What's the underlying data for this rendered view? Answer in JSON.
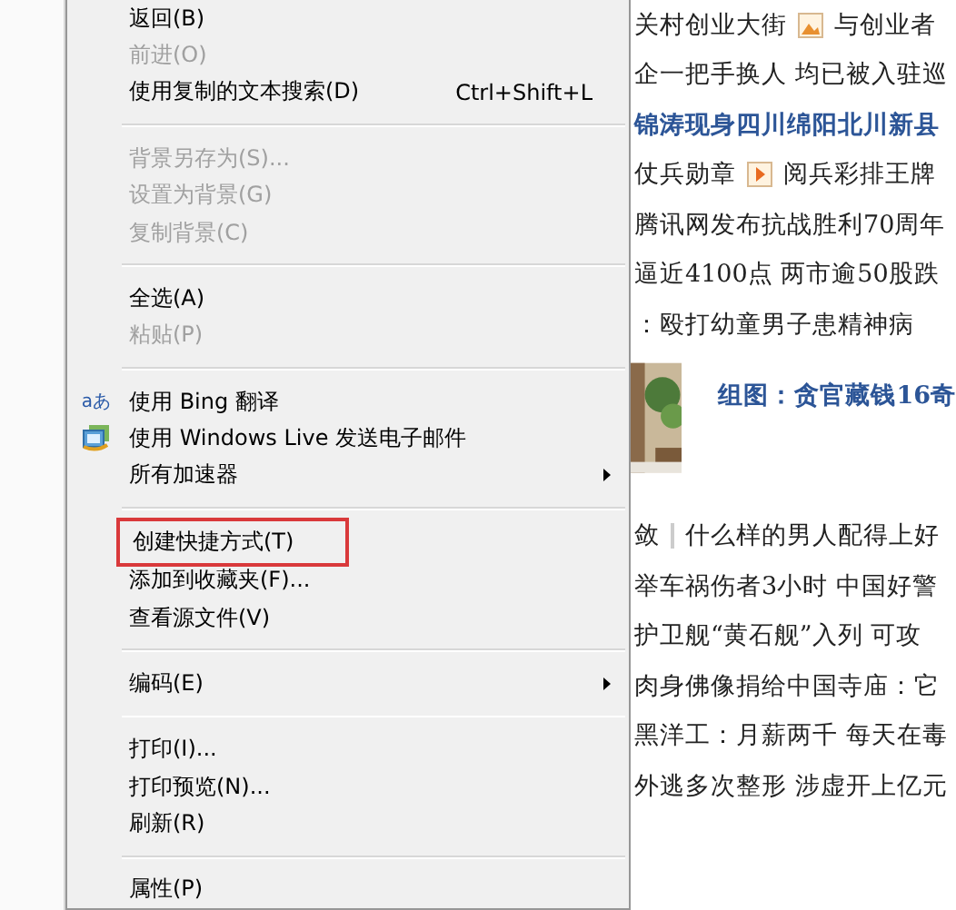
{
  "context_menu": {
    "groups": [
      [
        {
          "label": "返回(B)",
          "disabled": false
        },
        {
          "label": "前进(O)",
          "disabled": true
        },
        {
          "label": "使用复制的文本搜索(D)",
          "disabled": false,
          "shortcut": "Ctrl+Shift+L"
        }
      ],
      [
        {
          "label": "背景另存为(S)...",
          "disabled": true
        },
        {
          "label": "设置为背景(G)",
          "disabled": true
        },
        {
          "label": "复制背景(C)",
          "disabled": true
        }
      ],
      [
        {
          "label": "全选(A)",
          "disabled": false
        },
        {
          "label": "粘贴(P)",
          "disabled": true
        }
      ],
      [
        {
          "label": "使用 Bing 翻译",
          "disabled": false,
          "kind": "text_icon",
          "icon_text": "aあ"
        },
        {
          "label": "使用 Windows Live 发送电子邮件",
          "disabled": false,
          "kind": "image_icon"
        },
        {
          "label": "所有加速器",
          "disabled": false,
          "submenu": true
        }
      ],
      [
        {
          "label": "创建快捷方式(T)",
          "disabled": false,
          "highlighted": true
        },
        {
          "label": "添加到收藏夹(F)...",
          "disabled": false
        },
        {
          "label": "查看源文件(V)",
          "disabled": false
        }
      ],
      [
        {
          "label": "编码(E)",
          "disabled": false,
          "submenu": true
        }
      ],
      [
        {
          "label": "打印(I)...",
          "disabled": false
        },
        {
          "label": "打印预览(N)...",
          "disabled": false
        },
        {
          "label": "刷新(R)",
          "disabled": false
        }
      ],
      [
        {
          "label": "属性(P)",
          "disabled": false
        }
      ]
    ]
  },
  "news": [
    {
      "kind": "image_link",
      "parts": [
        "关村创业大街",
        "与创业者"
      ]
    },
    {
      "kind": "link",
      "parts": [
        "企一把手换人 均已被入驻巡"
      ]
    },
    {
      "kind": "headline",
      "parts": [
        "锦涛现身四川绵阳北川新县"
      ]
    },
    {
      "kind": "video_link",
      "parts": [
        "仗兵勋章",
        "阅兵彩排王牌"
      ]
    },
    {
      "kind": "link",
      "parts": [
        "腾讯网发布抗战胜利70周年"
      ]
    },
    {
      "kind": "link",
      "parts": [
        "逼近4100点 两市逾50股跌"
      ]
    },
    {
      "kind": "link",
      "parts": [
        "：殴打幼童男子患精神病"
      ]
    },
    {
      "parts": [
        "组图：贪官藏钱16奇"
      ]
    },
    {
      "kind": "divided_link",
      "parts": [
        "敛",
        "什么样的男人配得上好"
      ]
    },
    {
      "kind": "link",
      "parts": [
        "举车祸伤者3小时 中国好警"
      ]
    },
    {
      "kind": "link",
      "parts": [
        "护卫舰“黄石舰”入列 可攻"
      ]
    },
    {
      "kind": "link",
      "parts": [
        "肉身佛像捐给中国寺庙：它"
      ]
    },
    {
      "kind": "link",
      "parts": [
        "黑洋工：月薪两千 每天在毒"
      ]
    },
    {
      "kind": "link",
      "parts": [
        "外逃多次整形 涉虚开上亿元"
      ]
    }
  ]
}
